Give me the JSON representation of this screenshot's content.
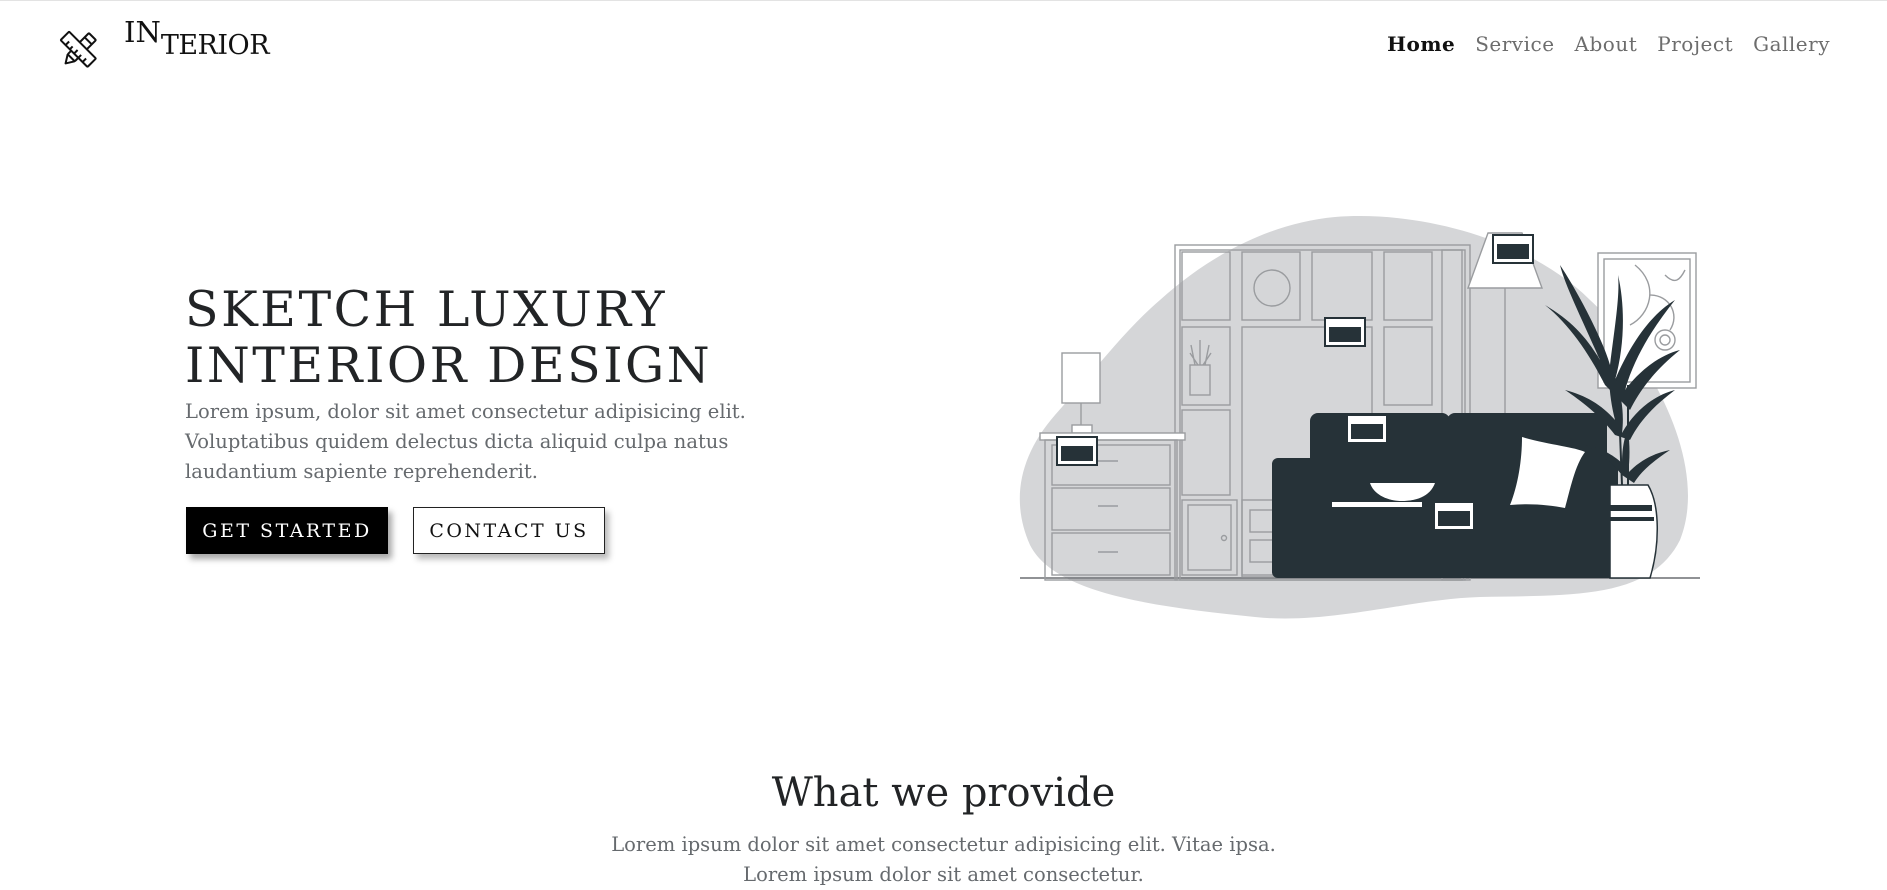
{
  "brand": {
    "icon": "crossed-tools-icon",
    "first_letters": "In",
    "rest": "terior"
  },
  "nav": {
    "items": [
      {
        "label": "Home",
        "active": true
      },
      {
        "label": "Service",
        "active": false
      },
      {
        "label": "About",
        "active": false
      },
      {
        "label": "Project",
        "active": false
      },
      {
        "label": "Gallery",
        "active": false
      }
    ]
  },
  "hero": {
    "title_line1": "SKETCH LUXURY",
    "title_line2": "INTERIOR DESIGN",
    "description": "Lorem ipsum, dolor sit amet consectetur adipisicing elit. Voluptatibus quidem delectus dicta aliquid culpa natus laudantium sapiente reprehenderit.",
    "primary_button": "GET STARTED",
    "secondary_button": "CONTACT US",
    "illustration": "living-room-sketch-illustration"
  },
  "services": {
    "title": "What we provide",
    "description_line1": "Lorem ipsum dolor sit amet consectetur adipisicing elit. Vitae ipsa.",
    "description_line2": "Lorem ipsum dolor sit amet consectetur."
  },
  "colors": {
    "accent": "#000000",
    "heading": "#222426",
    "body_text": "#666a6e",
    "blob": "#d5d6d8",
    "sofa": "#263238"
  }
}
